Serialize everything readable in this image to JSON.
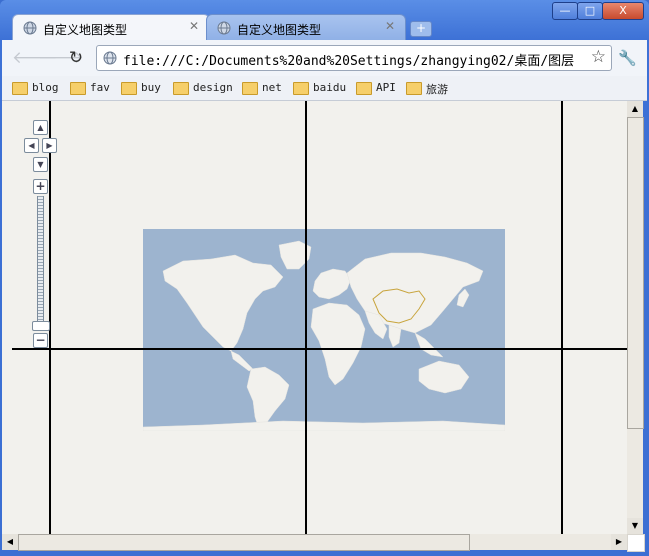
{
  "window": {
    "minimize_label": "—",
    "maximize_label": "□",
    "close_label": "X"
  },
  "tabs": [
    {
      "title": "自定义地图类型",
      "active": true
    },
    {
      "title": "自定义地图类型",
      "active": false
    }
  ],
  "toolbar": {
    "url": "file:///C:/Documents%20and%20Settings/zhangying02/桌面/图层"
  },
  "bookmarks": [
    "blog",
    "fav",
    "buy",
    "design",
    "net",
    "baidu",
    "API",
    "旅游"
  ],
  "map": {
    "ocean_color": "#9db4cf",
    "land_color": "#f2f1ed",
    "highlight_border_color": "#c8a43c"
  }
}
